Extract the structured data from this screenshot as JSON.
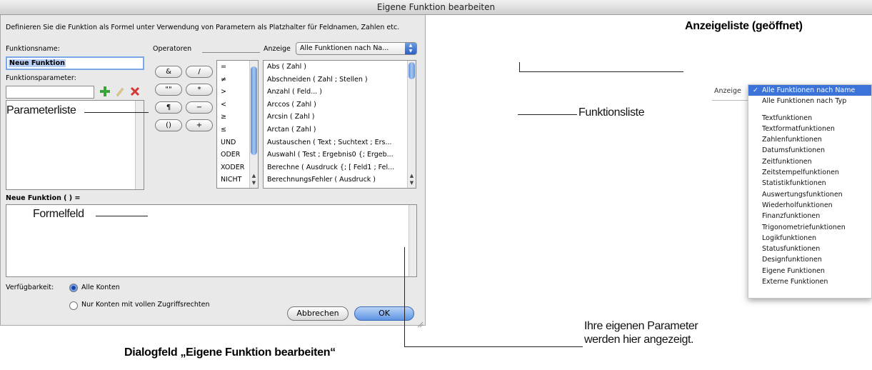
{
  "dialog": {
    "title": "Eigene Funktion bearbeiten",
    "description": "Definieren Sie die Funktion als Formel unter Verwendung von Parametern als Platzhalter für Feldnamen, Zahlen etc.",
    "function_name_label": "Funktionsname:",
    "function_name_value": "Neue Funktion",
    "parameters_label": "Funktionsparameter:",
    "operators_label": "Operatoren",
    "view_label": "Anzeige",
    "view_value": "Alle Funktionen nach Na...",
    "operator_buttons": [
      "&",
      "/",
      "\"\"",
      "*",
      "¶",
      "−",
      "()",
      "+"
    ],
    "operator_list": [
      "=",
      "≠",
      ">",
      "<",
      "≥",
      "≤",
      "UND",
      "ODER",
      "XODER",
      "NICHT"
    ],
    "function_list": [
      "Abs ( Zahl )",
      "Abschneiden ( Zahl ; Stellen )",
      "Anzahl ( Feld... )",
      "Arccos ( Zahl )",
      "Arcsin ( Zahl )",
      "Arctan ( Zahl )",
      "Austauschen ( Text ; Suchtext ; Ers...",
      "Auswahl ( Test ; Ergebnis0 {; Ergeb...",
      "Berechne ( Ausdruck {; [ Feld1 ; Fel...",
      "BerechnungsFehler ( Ausdruck )"
    ],
    "formula_header": "Neue Funktion (  ) =",
    "availability_label": "Verfügbarkeit:",
    "availability_options": [
      "Alle Konten",
      "Nur Konten mit vollen Zugriffsrechten"
    ],
    "cancel_label": "Abbrechen",
    "ok_label": "OK"
  },
  "callouts": {
    "parameter_list": "Parameterliste",
    "formula_field": "Formelfeld",
    "function_list": "Funktionsliste",
    "own_params_line1": "Ihre eigenen Parameter",
    "own_params_line2": "werden hier angezeigt.",
    "dialog_caption": "Dialogfeld „Eigene Funktion bearbeiten“",
    "view_list_caption": "Anzeigeliste (geöffnet)"
  },
  "menu": {
    "label": "Anzeige",
    "items": [
      "Alle Funktionen nach Name",
      "Alle Funktionen nach Typ",
      "",
      "Textfunktionen",
      "Textformatfunktionen",
      "Zahlenfunktionen",
      "Datumsfunktionen",
      "Zeitfunktionen",
      "Zeitstempelfunktionen",
      "Statistikfunktionen",
      "Auswertungsfunktionen",
      "Wiederholfunktionen",
      "Finanzfunktionen",
      "Trigonometriefunktionen",
      "Logikfunktionen",
      "Statusfunktionen",
      "Designfunktionen",
      "Eigene Funktionen",
      "Externe Funktionen"
    ],
    "checkmark": "✓"
  },
  "colors": {
    "accent": "#3b73d9",
    "add_icon": "#3aa53a",
    "delete_icon": "#d23a3a"
  }
}
